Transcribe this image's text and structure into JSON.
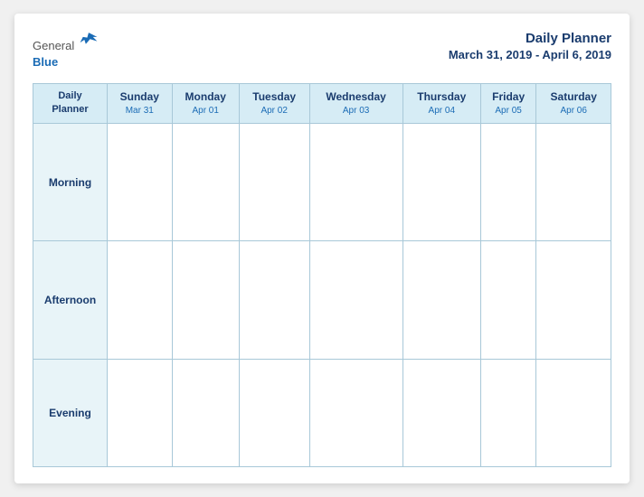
{
  "header": {
    "logo": {
      "general": "General",
      "blue": "Blue",
      "bird_alt": "GeneralBlue bird logo"
    },
    "title": "Daily Planner",
    "date_range": "March 31, 2019 - April 6, 2019"
  },
  "table": {
    "first_col_line1": "Daily",
    "first_col_line2": "Planner",
    "columns": [
      {
        "day": "Sunday",
        "date": "Mar 31"
      },
      {
        "day": "Monday",
        "date": "Apr 01"
      },
      {
        "day": "Tuesday",
        "date": "Apr 02"
      },
      {
        "day": "Wednesday",
        "date": "Apr 03"
      },
      {
        "day": "Thursday",
        "date": "Apr 04"
      },
      {
        "day": "Friday",
        "date": "Apr 05"
      },
      {
        "day": "Saturday",
        "date": "Apr 06"
      }
    ],
    "rows": [
      {
        "label": "Morning"
      },
      {
        "label": "Afternoon"
      },
      {
        "label": "Evening"
      }
    ]
  }
}
